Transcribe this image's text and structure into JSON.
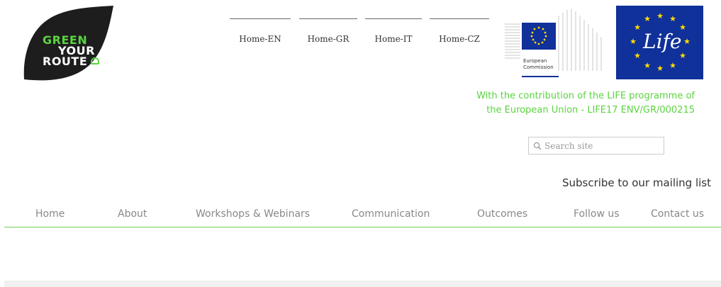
{
  "logo": {
    "line1": "GREEN",
    "line2": "YOUR",
    "line3": "ROUTE"
  },
  "lang_nav": [
    {
      "label": "Home-EN"
    },
    {
      "label": "Home-GR"
    },
    {
      "label": "Home-IT"
    },
    {
      "label": "Home-CZ"
    }
  ],
  "ec_logo": {
    "line1": "European",
    "line2": "Commission"
  },
  "life_logo": {
    "text": "Life"
  },
  "contribution": {
    "line1": "With the contribution of the LIFE programme of",
    "line2": "the European Union - LIFE17 ENV/GR/000215"
  },
  "search": {
    "placeholder": "Search site"
  },
  "subscribe": {
    "label": "Subscribe to our mailing list"
  },
  "main_nav": [
    {
      "label": "Home"
    },
    {
      "label": "About"
    },
    {
      "label": "Workshops & Webinars"
    },
    {
      "label": "Communication"
    },
    {
      "label": "Outcomes"
    },
    {
      "label": "Follow us"
    },
    {
      "label": "Contact us"
    }
  ],
  "colors": {
    "accent_green": "#5ad43f",
    "leaf_dark": "#1d1d1d",
    "eu_blue": "#10309a",
    "eu_yellow": "#ffdd00"
  }
}
